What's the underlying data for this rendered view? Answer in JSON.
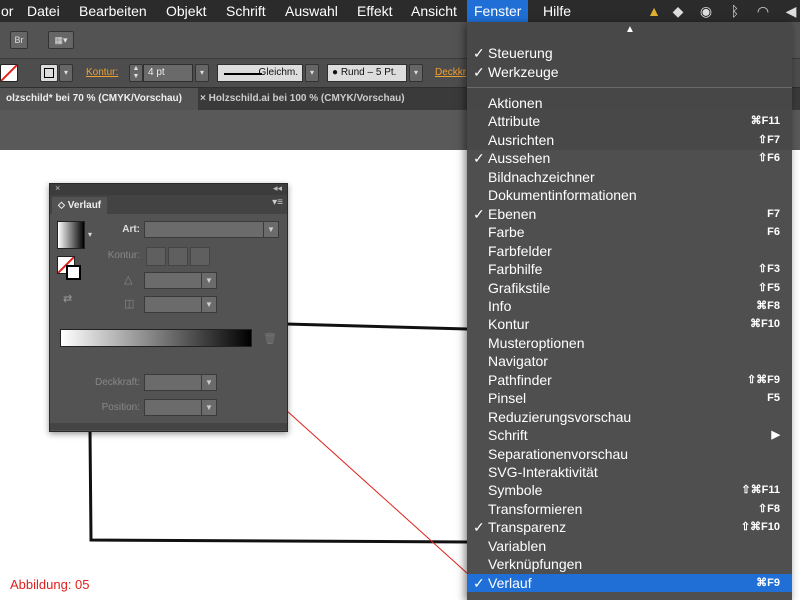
{
  "menubar": {
    "items": [
      "or",
      "Datei",
      "Bearbeiten",
      "Objekt",
      "Schrift",
      "Auswahl",
      "Effekt",
      "Ansicht",
      "Fenster",
      "Hilfe"
    ],
    "icons": [
      "bell-icon",
      "dropbox-icon",
      "sync-icon",
      "bluetooth-icon",
      "wifi-icon",
      "volume-icon"
    ]
  },
  "toolbar": {
    "br_label": "Br",
    "kontur_label": "Kontur:",
    "kontur_value": "4 pt",
    "stroke_style": "Gleichm.",
    "brush": "Rund – 5 Pt.",
    "deckkraft_label": "Deckkr"
  },
  "tabs": [
    {
      "label": "olzschild* bei 70 % (CMYK/Vorschau)",
      "close": "×",
      "active": true
    },
    {
      "label": "Holzschild.ai bei 100 % (CMYK/Vorschau)",
      "close": "×",
      "active": false
    }
  ],
  "panel": {
    "title": "Verlauf",
    "art_label": "Art:",
    "kontur_label": "Kontur:",
    "deckkraft_label": "Deckkraft:",
    "position_label": "Position:"
  },
  "menu": {
    "top_items": [
      {
        "label": "Steuerung",
        "checked": true,
        "shortcut": ""
      },
      {
        "label": "Werkzeuge",
        "checked": true,
        "shortcut": ""
      }
    ],
    "items": [
      {
        "label": "Aktionen",
        "checked": false,
        "shortcut": ""
      },
      {
        "label": "Attribute",
        "checked": false,
        "shortcut": "⌘F11"
      },
      {
        "label": "Ausrichten",
        "checked": false,
        "shortcut": "⇧F7"
      },
      {
        "label": "Aussehen",
        "checked": true,
        "shortcut": "⇧F6"
      },
      {
        "label": "Bildnachzeichner",
        "checked": false,
        "shortcut": ""
      },
      {
        "label": "Dokumentinformationen",
        "checked": false,
        "shortcut": ""
      },
      {
        "label": "Ebenen",
        "checked": true,
        "shortcut": "F7"
      },
      {
        "label": "Farbe",
        "checked": false,
        "shortcut": "F6"
      },
      {
        "label": "Farbfelder",
        "checked": false,
        "shortcut": ""
      },
      {
        "label": "Farbhilfe",
        "checked": false,
        "shortcut": "⇧F3"
      },
      {
        "label": "Grafikstile",
        "checked": false,
        "shortcut": "⇧F5"
      },
      {
        "label": "Info",
        "checked": false,
        "shortcut": "⌘F8"
      },
      {
        "label": "Kontur",
        "checked": false,
        "shortcut": "⌘F10"
      },
      {
        "label": "Musteroptionen",
        "checked": false,
        "shortcut": ""
      },
      {
        "label": "Navigator",
        "checked": false,
        "shortcut": ""
      },
      {
        "label": "Pathfinder",
        "checked": false,
        "shortcut": "⇧⌘F9"
      },
      {
        "label": "Pinsel",
        "checked": false,
        "shortcut": "F5"
      },
      {
        "label": "Reduzierungsvorschau",
        "checked": false,
        "shortcut": ""
      },
      {
        "label": "Schrift",
        "checked": false,
        "shortcut": "▶"
      },
      {
        "label": "Separationenvorschau",
        "checked": false,
        "shortcut": ""
      },
      {
        "label": "SVG-Interaktivität",
        "checked": false,
        "shortcut": ""
      },
      {
        "label": "Symbole",
        "checked": false,
        "shortcut": "⇧⌘F11"
      },
      {
        "label": "Transformieren",
        "checked": false,
        "shortcut": "⇧F8"
      },
      {
        "label": "Transparenz",
        "checked": true,
        "shortcut": "⇧⌘F10"
      },
      {
        "label": "Variablen",
        "checked": false,
        "shortcut": ""
      },
      {
        "label": "Verknüpfungen",
        "checked": false,
        "shortcut": ""
      },
      {
        "label": "Verlauf",
        "checked": true,
        "shortcut": "⌘F9",
        "selected": true
      }
    ]
  },
  "caption": "Abbildung: 05",
  "colors": {
    "menu_highlight": "#1f6fd6",
    "annotation": "#e0201c",
    "kontur_label": "#f0a030"
  }
}
